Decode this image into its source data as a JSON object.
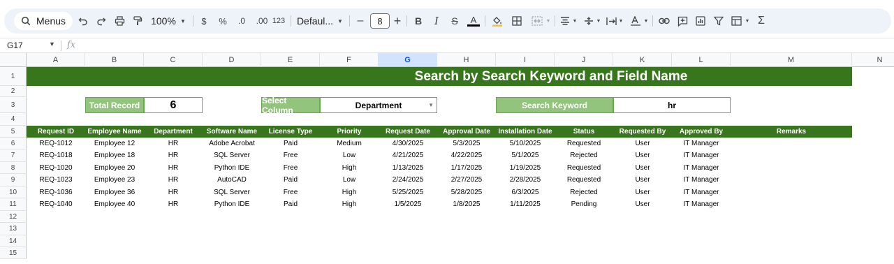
{
  "toolbar": {
    "menus_label": "Menus",
    "zoom": "100%",
    "currency": "$",
    "percent": "%",
    "dec_decrease": ".0",
    "dec_increase": ".00",
    "number_format": "123",
    "font": "Defaul...",
    "font_size": "8",
    "minus": "–",
    "plus": "+",
    "bold": "B",
    "italic": "I",
    "strike": "S",
    "text_color": "A",
    "sum": "Σ"
  },
  "formula_bar": {
    "cell_ref": "G17",
    "fx": "fx"
  },
  "columns": [
    "A",
    "B",
    "C",
    "D",
    "E",
    "F",
    "G",
    "H",
    "I",
    "J",
    "K",
    "L",
    "M",
    "N"
  ],
  "selected_column": "G",
  "rows": [
    "1",
    "2",
    "3",
    "4",
    "5",
    "6",
    "7",
    "8",
    "9",
    "10",
    "11",
    "12",
    "13",
    "14",
    "15"
  ],
  "sheet": {
    "title": "Search by Search Keyword and Field Name",
    "total_record_label": "Total Record",
    "total_record_value": "6",
    "select_column_label": "Select Column",
    "select_column_value": "Department",
    "search_keyword_label": "Search Keyword",
    "search_keyword_value": "hr",
    "headers": [
      "Request ID",
      "Employee Name",
      "Department",
      "Software Name",
      "License Type",
      "Priority",
      "Request Date",
      "Approval Date",
      "Installation Date",
      "Status",
      "Requested By",
      "Approved By",
      "Remarks"
    ],
    "records": [
      [
        "REQ-1012",
        "Employee 12",
        "HR",
        "Adobe Acrobat",
        "Paid",
        "Medium",
        "4/30/2025",
        "5/3/2025",
        "5/10/2025",
        "Requested",
        "User",
        "IT Manager",
        ""
      ],
      [
        "REQ-1018",
        "Employee 18",
        "HR",
        "SQL Server",
        "Free",
        "Low",
        "4/21/2025",
        "4/22/2025",
        "5/1/2025",
        "Rejected",
        "User",
        "IT Manager",
        ""
      ],
      [
        "REQ-1020",
        "Employee 20",
        "HR",
        "Python IDE",
        "Free",
        "High",
        "1/13/2025",
        "1/17/2025",
        "1/19/2025",
        "Requested",
        "User",
        "IT Manager",
        ""
      ],
      [
        "REQ-1023",
        "Employee 23",
        "HR",
        "AutoCAD",
        "Paid",
        "Low",
        "2/24/2025",
        "2/27/2025",
        "2/28/2025",
        "Requested",
        "User",
        "IT Manager",
        ""
      ],
      [
        "REQ-1036",
        "Employee 36",
        "HR",
        "SQL Server",
        "Free",
        "High",
        "5/25/2025",
        "5/28/2025",
        "6/3/2025",
        "Rejected",
        "User",
        "IT Manager",
        ""
      ],
      [
        "REQ-1040",
        "Employee 40",
        "HR",
        "Python IDE",
        "Paid",
        "High",
        "1/5/2025",
        "1/8/2025",
        "1/11/2025",
        "Pending",
        "User",
        "IT Manager",
        ""
      ]
    ]
  },
  "colors": {
    "header_green": "#38761d",
    "label_green": "#93c47d",
    "selected_col": "#d3e3fd"
  }
}
